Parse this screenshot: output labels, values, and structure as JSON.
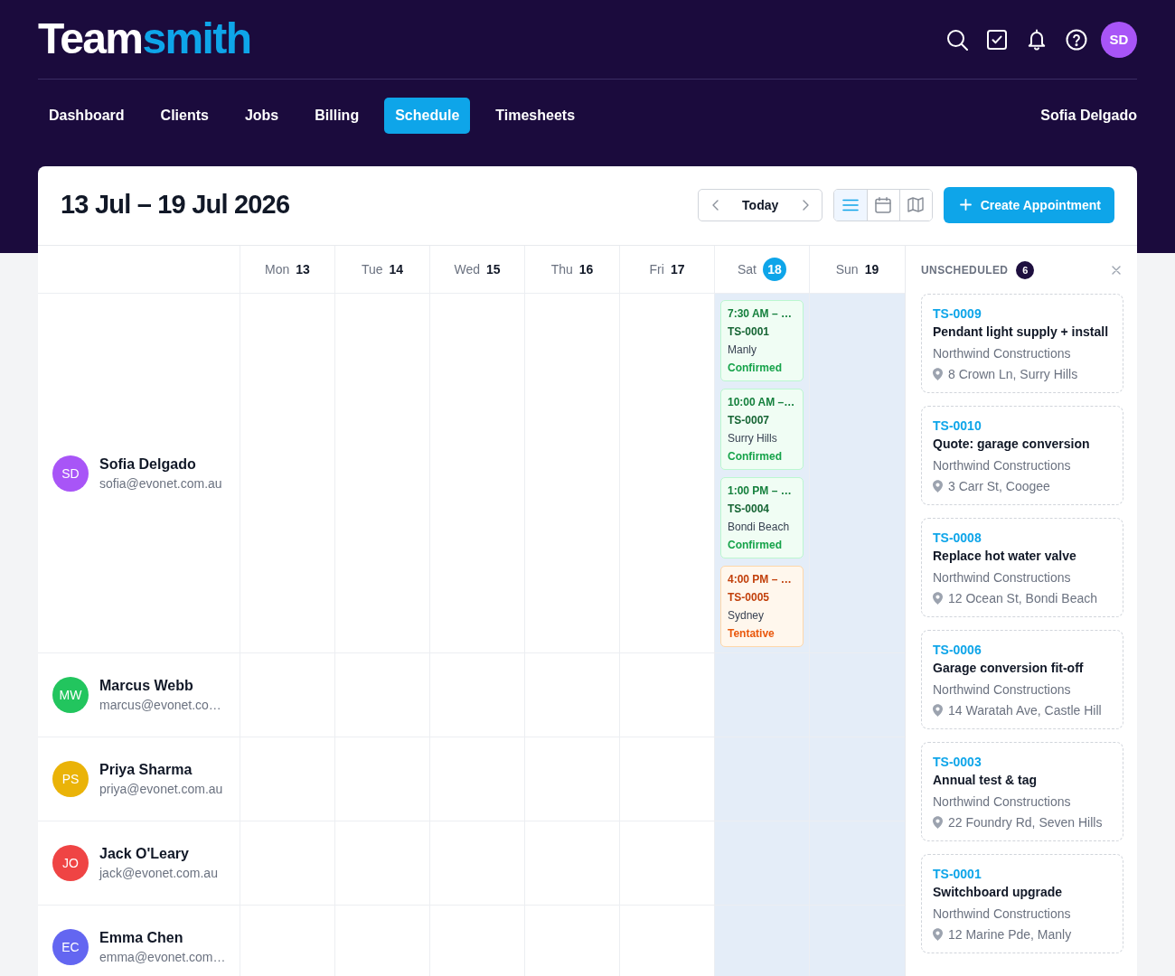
{
  "app": {
    "logo": {
      "first": "Team",
      "second": "smith"
    },
    "avatar": "SD",
    "user_name": "Sofia Delgado"
  },
  "nav": [
    {
      "label": "Dashboard",
      "selected": false
    },
    {
      "label": "Clients",
      "selected": false
    },
    {
      "label": "Jobs",
      "selected": false
    },
    {
      "label": "Billing",
      "selected": false
    },
    {
      "label": "Schedule",
      "selected": true
    },
    {
      "label": "Timesheets",
      "selected": false
    }
  ],
  "toolbar": {
    "title": "13 Jul – 19 Jul 2026",
    "today_button": "Today",
    "views": [
      {
        "kind": "list",
        "selected": true
      },
      {
        "kind": "calendar",
        "selected": false
      },
      {
        "kind": "map",
        "selected": false
      }
    ],
    "create_button": "Create Appointment"
  },
  "days": [
    {
      "weekday": "Mon",
      "date": "13",
      "today": false,
      "weekend": false
    },
    {
      "weekday": "Tue",
      "date": "14",
      "today": false,
      "weekend": false
    },
    {
      "weekday": "Wed",
      "date": "15",
      "today": false,
      "weekend": false
    },
    {
      "weekday": "Thu",
      "date": "16",
      "today": false,
      "weekend": false
    },
    {
      "weekday": "Fri",
      "date": "17",
      "today": false,
      "weekend": false
    },
    {
      "weekday": "Sat",
      "date": "18",
      "today": true,
      "weekend": true
    },
    {
      "weekday": "Sun",
      "date": "19",
      "today": false,
      "weekend": true
    }
  ],
  "staff": [
    {
      "initials": "SD",
      "name": "Sofia Delgado",
      "email": "sofia@evonet.com.au",
      "color": "#a855f7",
      "cells": [
        {},
        {},
        {},
        {},
        {},
        {
          "events": [
            {
              "kind": "confirmed",
              "time": "7:30 AM – …",
              "job": "TS-0001",
              "location": "Manly",
              "status": "Confirmed"
            },
            {
              "kind": "confirmed",
              "time": "10:00 AM –…",
              "job": "TS-0007",
              "location": "Surry Hills",
              "status": "Confirmed"
            },
            {
              "kind": "confirmed",
              "time": "1:00 PM – …",
              "job": "TS-0004",
              "location": "Bondi Beach",
              "status": "Confirmed"
            },
            {
              "kind": "tentative",
              "time": "4:00 PM – …",
              "job": "TS-0005",
              "location": "Sydney",
              "status": "Tentative"
            }
          ]
        },
        {}
      ]
    },
    {
      "initials": "MW",
      "name": "Marcus Webb",
      "email": "marcus@evonet.co…",
      "color": "#22c55e"
    },
    {
      "initials": "PS",
      "name": "Priya Sharma",
      "email": "priya@evonet.com.au",
      "color": "#eab308"
    },
    {
      "initials": "JO",
      "name": "Jack O'Leary",
      "email": "jack@evonet.com.au",
      "color": "#ef4444"
    },
    {
      "initials": "EC",
      "name": "Emma Chen",
      "email": "emma@evonet.com…",
      "color": "#6366f1"
    }
  ],
  "unscheduled": {
    "title": "UNSCHEDULED",
    "count": "6",
    "jobs": [
      {
        "id": "TS-0009",
        "title": "Pendant light supply + install",
        "client": "Northwind Constructions",
        "address": "8 Crown Ln, Surry Hills"
      },
      {
        "id": "TS-0010",
        "title": "Quote: garage conversion",
        "client": "Northwind Constructions",
        "address": "3 Carr St, Coogee"
      },
      {
        "id": "TS-0008",
        "title": "Replace hot water valve",
        "client": "Northwind Constructions",
        "address": "12 Ocean St, Bondi Beach"
      },
      {
        "id": "TS-0006",
        "title": "Garage conversion fit-off",
        "client": "Northwind Constructions",
        "address": "14 Waratah Ave, Castle Hill"
      },
      {
        "id": "TS-0003",
        "title": "Annual test & tag",
        "client": "Northwind Constructions",
        "address": "22 Foundry Rd, Seven Hills"
      },
      {
        "id": "TS-0001",
        "title": "Switchboard upgrade",
        "client": "Northwind Constructions",
        "address": "12 Marine Pde, Manly"
      }
    ]
  }
}
